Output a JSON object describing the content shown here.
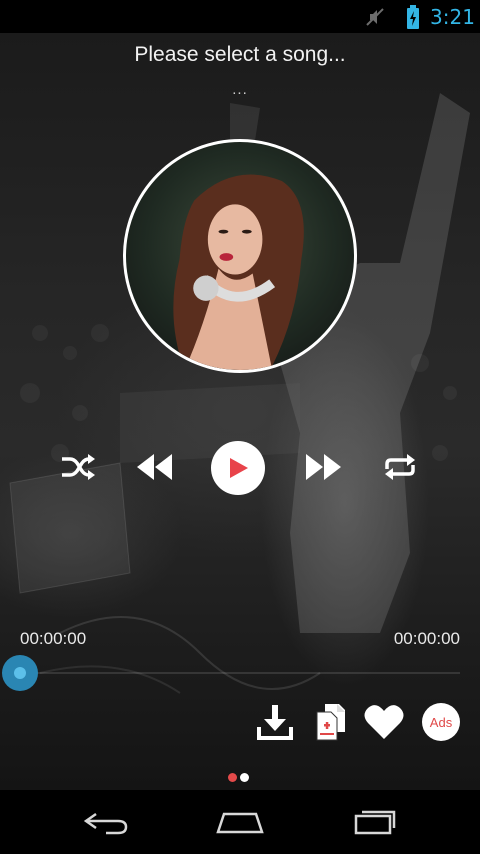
{
  "status_bar": {
    "clock": "3:21",
    "icons": [
      "mute-icon",
      "battery-charging-icon"
    ],
    "clock_color": "#33b5e5"
  },
  "player": {
    "title": "Please select a song...",
    "artist": "...",
    "album_art": "album-art-photo",
    "elapsed": "00:00:00",
    "total": "00:00:00",
    "progress": 0
  },
  "controls": {
    "shuffle": "shuffle-icon",
    "previous": "rewind-icon",
    "play": "play-icon",
    "next": "fast-forward-icon",
    "repeat": "repeat-icon",
    "play_color": "#e8434a"
  },
  "actions": {
    "download": "download-icon",
    "add_to_playlist": "add-file-icon",
    "favorite": "heart-icon",
    "ads_label": "Ads",
    "accent": "#e04848"
  },
  "pager": {
    "active_index": 0,
    "count": 2
  },
  "nav_bar": {
    "icons": [
      "back-icon",
      "home-icon",
      "recent-apps-icon"
    ]
  },
  "colors": {
    "seek_thumb": "#2a86b3"
  }
}
